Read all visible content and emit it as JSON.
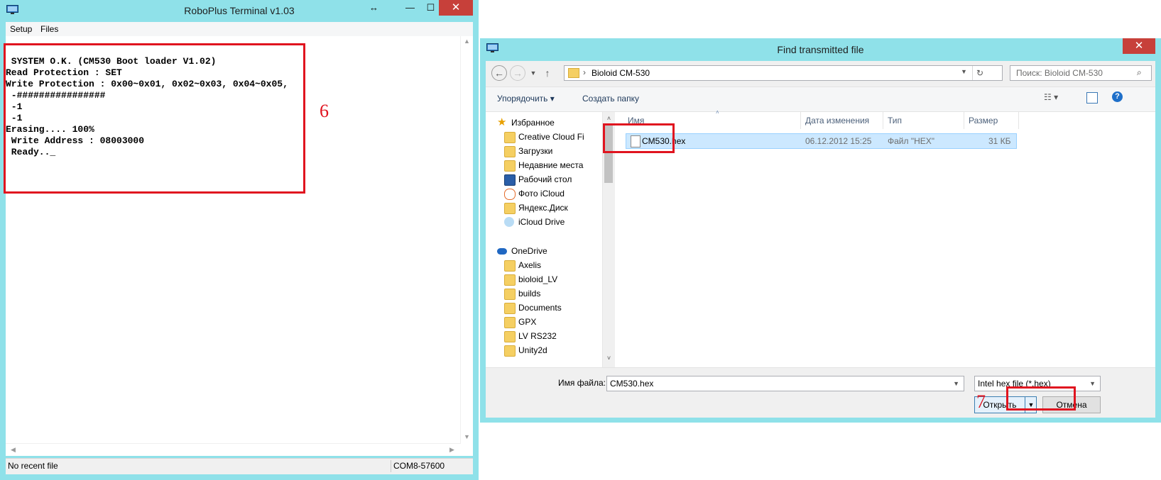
{
  "terminal": {
    "title": "RoboPlus Terminal v1.03",
    "menu": [
      "Setup",
      "Files"
    ],
    "console_lines": [
      " SYSTEM O.K. (CM530 Boot loader V1.02)",
      "Read Protection : SET",
      "Write Protection : 0x00~0x01, 0x02~0x03, 0x04~0x05,",
      " -################",
      " -1",
      " -1",
      "Erasing.... 100%",
      " Write Address : 08003000",
      " Ready.._"
    ],
    "status_left": "No recent file",
    "status_right": "COM8-57600",
    "annotation": "6",
    "controls": {
      "resize": "↔",
      "minimize": "—",
      "maximize": "☐",
      "close": "✕"
    }
  },
  "dialog": {
    "title": "Find transmitted file",
    "breadcrumb_sep": "›",
    "breadcrumb": "Bioloid CM-530",
    "search_placeholder": "Поиск: Bioloid CM-530",
    "organize": "Упорядочить ▾",
    "new_folder": "Создать папку",
    "favorites_label": "Избранное",
    "favorites": [
      {
        "label": "Creative Cloud Fi",
        "icon": "folder-icon"
      },
      {
        "label": "Загрузки",
        "icon": "downloads-icon"
      },
      {
        "label": "Недавние места",
        "icon": "recent-places-icon"
      },
      {
        "label": "Рабочий стол",
        "icon": "desktop-icon"
      },
      {
        "label": "Фото iCloud",
        "icon": "icloud-photos-icon"
      },
      {
        "label": "Яндекс.Диск",
        "icon": "yandex-disk-icon"
      },
      {
        "label": "iCloud Drive",
        "icon": "icloud-drive-icon"
      }
    ],
    "onedrive_label": "OneDrive",
    "onedrive": [
      "Axelis",
      "bioloid_LV",
      "builds",
      "Documents",
      "GPX",
      "LV RS232",
      "Unity2d"
    ],
    "columns": [
      "Имя",
      "Дата изменения",
      "Тип",
      "Размер"
    ],
    "file": {
      "name": "CM530.hex",
      "modified": "06.12.2012 15:25",
      "type": "Файл \"HEX\"",
      "size": "31 КБ"
    },
    "filename_label": "Имя файла:",
    "filename_value": "CM530.hex",
    "filter_value": "Intel hex file (*.hex)",
    "open_label": "Открыть",
    "cancel_label": "Отмена",
    "annotation": "7",
    "close_glyph": "✕"
  },
  "colors": {
    "window_frame": "#8fe1e9",
    "close_button": "#c7403a",
    "annotation_red": "#e0141f",
    "selection": "#cce8ff"
  }
}
